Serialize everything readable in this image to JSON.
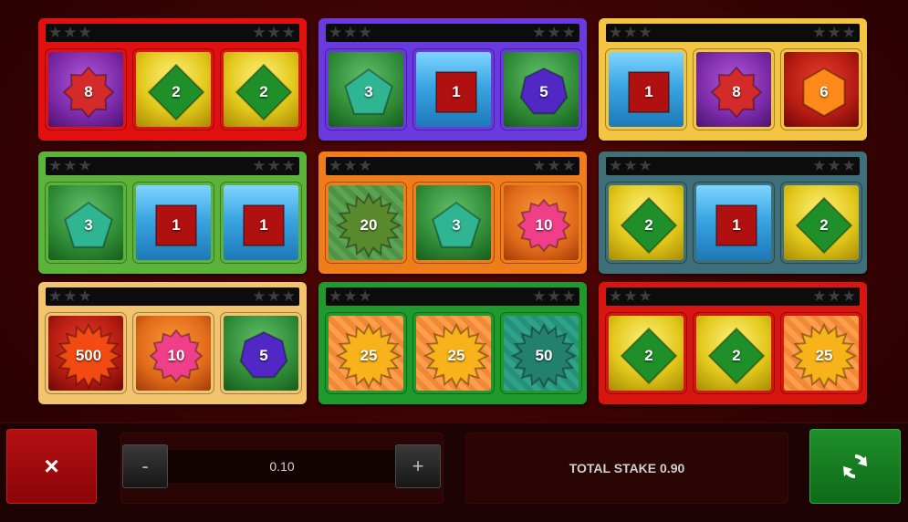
{
  "cards": [
    {
      "frame": "#e31010",
      "symbols": [
        {
          "value": "8",
          "shape": "star8",
          "color": "#d42a2a",
          "bg": "bg-purple"
        },
        {
          "value": "2",
          "shape": "diamond",
          "color": "#1f8f2a",
          "bg": "bg-yellow"
        },
        {
          "value": "2",
          "shape": "diamond",
          "color": "#1f8f2a",
          "bg": "bg-yellow"
        }
      ]
    },
    {
      "frame": "#6a3ae0",
      "symbols": [
        {
          "value": "3",
          "shape": "pentagon",
          "color": "#2fb592",
          "bg": "bg-green"
        },
        {
          "value": "1",
          "shape": "square",
          "color": "#b01010",
          "bg": "bg-blue"
        },
        {
          "value": "5",
          "shape": "heptagon",
          "color": "#5128c4",
          "bg": "bg-green"
        }
      ]
    },
    {
      "frame": "#f4c542",
      "symbols": [
        {
          "value": "1",
          "shape": "square",
          "color": "#b01010",
          "bg": "bg-blue"
        },
        {
          "value": "8",
          "shape": "star8",
          "color": "#d42a2a",
          "bg": "bg-purple"
        },
        {
          "value": "6",
          "shape": "hexagon",
          "color": "#ff8a1a",
          "bg": "bg-red"
        }
      ]
    },
    {
      "frame": "#5cb33a",
      "symbols": [
        {
          "value": "3",
          "shape": "pentagon",
          "color": "#2fb592",
          "bg": "bg-green"
        },
        {
          "value": "1",
          "shape": "square",
          "color": "#b01010",
          "bg": "bg-blue"
        },
        {
          "value": "1",
          "shape": "square",
          "color": "#b01010",
          "bg": "bg-blue"
        }
      ]
    },
    {
      "frame": "#f07c1a",
      "symbols": [
        {
          "value": "20",
          "shape": "burst",
          "color": "#5b8a2e",
          "bg": "bg-striped-green"
        },
        {
          "value": "3",
          "shape": "pentagon",
          "color": "#2fb592",
          "bg": "bg-green"
        },
        {
          "value": "10",
          "shape": "star12",
          "color": "#ef3f88",
          "bg": "bg-magenta"
        }
      ]
    },
    {
      "frame": "#3f6f78",
      "symbols": [
        {
          "value": "2",
          "shape": "diamond",
          "color": "#1f8f2a",
          "bg": "bg-yellow"
        },
        {
          "value": "1",
          "shape": "square",
          "color": "#b01010",
          "bg": "bg-blue"
        },
        {
          "value": "2",
          "shape": "diamond",
          "color": "#1f8f2a",
          "bg": "bg-yellow"
        }
      ]
    },
    {
      "frame": "#f2c46e",
      "symbols": [
        {
          "value": "500",
          "shape": "burst",
          "color": "#f24a12",
          "bg": "bg-red"
        },
        {
          "value": "10",
          "shape": "star12",
          "color": "#ef3f88",
          "bg": "bg-magenta"
        },
        {
          "value": "5",
          "shape": "heptagon",
          "color": "#5128c4",
          "bg": "bg-green"
        }
      ]
    },
    {
      "frame": "#1f9a2c",
      "symbols": [
        {
          "value": "25",
          "shape": "burst",
          "color": "#f8b21a",
          "bg": "bg-striped-orange"
        },
        {
          "value": "25",
          "shape": "burst",
          "color": "#f8b21a",
          "bg": "bg-striped-orange"
        },
        {
          "value": "50",
          "shape": "burst",
          "color": "#23806c",
          "bg": "bg-teal"
        }
      ]
    },
    {
      "frame": "#d8150f",
      "symbols": [
        {
          "value": "2",
          "shape": "diamond",
          "color": "#1f8f2a",
          "bg": "bg-yellow"
        },
        {
          "value": "2",
          "shape": "diamond",
          "color": "#1f8f2a",
          "bg": "bg-yellow"
        },
        {
          "value": "25",
          "shape": "burst",
          "color": "#f8b21a",
          "bg": "bg-striped-orange"
        }
      ]
    }
  ],
  "stars_left": "★★★",
  "stars_right": "★★★",
  "controls": {
    "close_label": "×",
    "decrease_label": "-",
    "increase_label": "+",
    "stake_value": "0.10",
    "total_stake": "TOTAL STAKE 0.90",
    "spin_icon": "refresh-icon"
  },
  "colors": {
    "background": "#3a0303",
    "spin_button": "#1f8f2b",
    "close_button": "#b30f12"
  }
}
